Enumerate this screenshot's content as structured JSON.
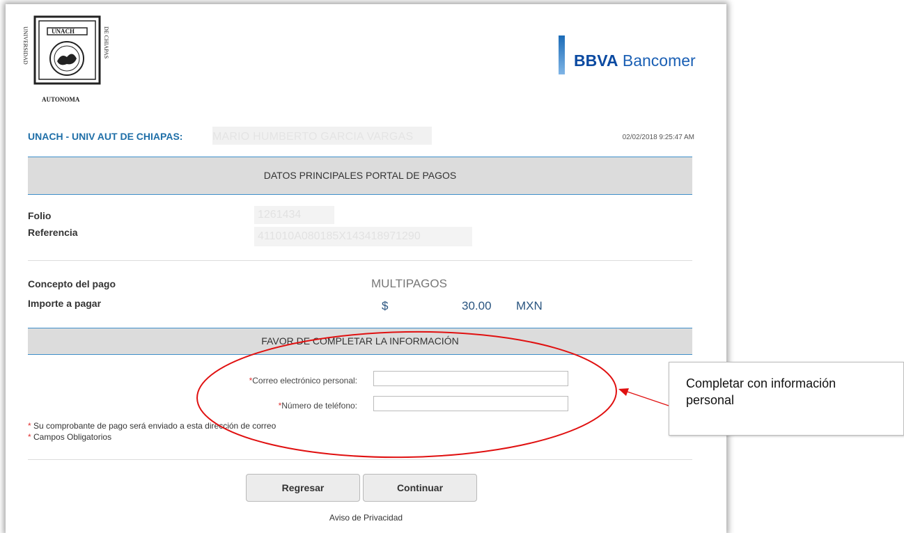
{
  "header": {
    "seal_text": {
      "top": "UNACH",
      "left": "UNIVERSIDAD",
      "right": "DE CHIAPAS",
      "bottom": "AUTONOMA"
    },
    "bank_logo": {
      "bold": "BBVA",
      "regular": "Bancomer"
    },
    "merchant_label": "UNACH - UNIV AUT DE CHIAPAS:",
    "customer_name": "MARIO HUMBERTO GARCIA VARGAS",
    "timestamp": "02/02/2018 9:25:47 AM"
  },
  "section_main": {
    "title": "DATOS PRINCIPALES PORTAL DE PAGOS",
    "folio_label": "Folio",
    "folio_value": "1261434",
    "reference_label": "Referencia",
    "reference_value": "411010A080185X143418971290"
  },
  "payment": {
    "concept_label": "Concepto del pago",
    "concept_value": "MULTIPAGOS",
    "amount_label": "Importe a pagar",
    "currency_symbol": "$",
    "amount": "30.00",
    "currency": "MXN"
  },
  "section_form": {
    "title": "FAVOR DE COMPLETAR LA INFORMACIÓN",
    "email_label": "Correo electrónico personal:",
    "phone_label": "Número de teléfono:",
    "required_mark": "*",
    "email_value": "",
    "phone_value": "",
    "note_receipt": "Su comprobante de pago será enviado a esta dirección de correo",
    "note_required": "Campos Obligatorios"
  },
  "buttons": {
    "back": "Regresar",
    "continue": "Continuar"
  },
  "footer": {
    "privacy": "Aviso de Privacidad"
  },
  "annotation": {
    "callout_text": "Completar con información personal",
    "color": "#e01010"
  }
}
